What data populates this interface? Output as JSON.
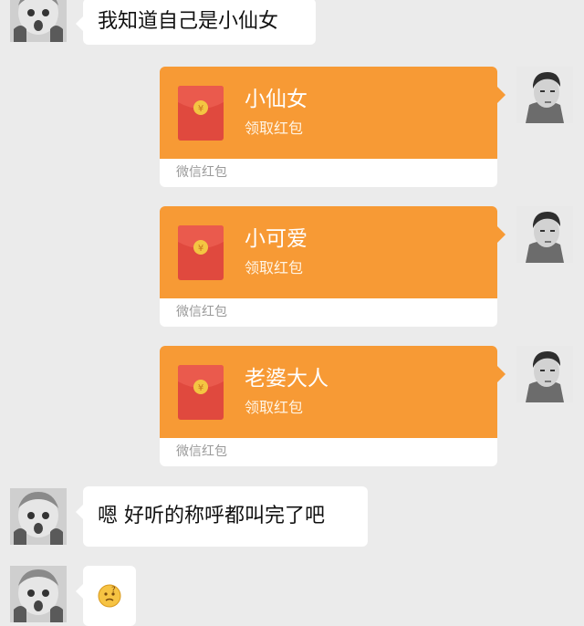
{
  "messages": [
    {
      "id": "m1",
      "from": "other",
      "type": "text",
      "text": "我知道自己是小仙女"
    },
    {
      "id": "m2",
      "from": "me",
      "type": "red_packet",
      "title": "小仙女",
      "action": "领取红包",
      "footer": "微信红包"
    },
    {
      "id": "m3",
      "from": "me",
      "type": "red_packet",
      "title": "小可爱",
      "action": "领取红包",
      "footer": "微信红包"
    },
    {
      "id": "m4",
      "from": "me",
      "type": "red_packet",
      "title": "老婆大人",
      "action": "领取红包",
      "footer": "微信红包"
    },
    {
      "id": "m5",
      "from": "other",
      "type": "text",
      "text": "嗯 好听的称呼都叫完了吧"
    },
    {
      "id": "m6",
      "from": "other",
      "type": "emoji",
      "emoji": "confused-face-icon"
    }
  ],
  "colors": {
    "background": "#ebebeb",
    "red_packet_orange": "#f79a35",
    "envelope_red": "#e0493e",
    "bubble_white": "#ffffff"
  }
}
